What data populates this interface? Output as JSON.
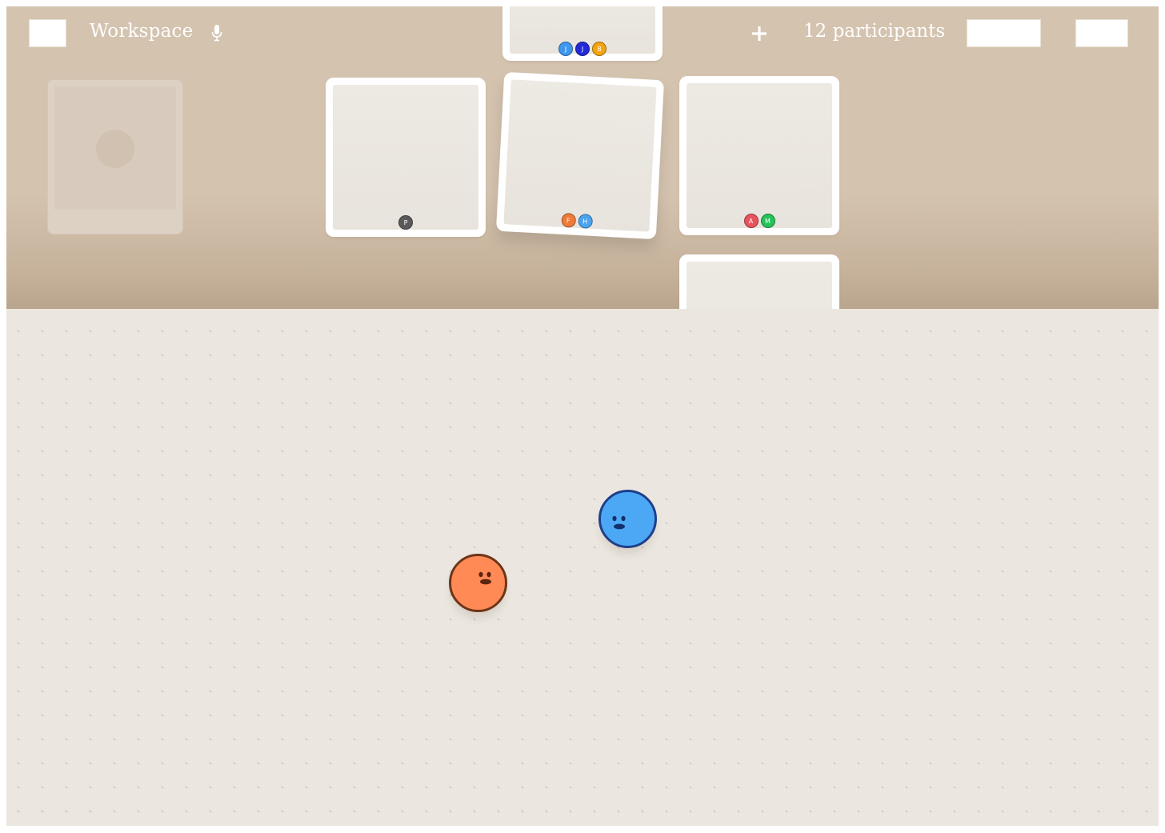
{
  "header": {
    "workspace_title": "Workspace",
    "participants_count": "12 participants",
    "icons": {
      "menu": "menu-button",
      "mic": "microphone-icon",
      "add": "plus-icon"
    }
  },
  "rooms": {
    "top": {
      "avatars": [
        {
          "initial": "J",
          "color": "#3f97ef"
        },
        {
          "initial": "J",
          "color": "#2329d8"
        },
        {
          "initial": "B",
          "color": "#f3a40e"
        }
      ]
    },
    "left": {
      "avatars": [
        {
          "initial": "P",
          "color": "#5a5a5a"
        }
      ]
    },
    "center": {
      "avatars": [
        {
          "initial": "F",
          "color": "#ef7b3a"
        },
        {
          "initial": "H",
          "color": "#4ca3ee"
        }
      ]
    },
    "right": {
      "avatars": [
        {
          "initial": "A",
          "color": "#e8545d"
        },
        {
          "initial": "M",
          "color": "#25c25a"
        }
      ]
    }
  },
  "characters": [
    {
      "name": "orange",
      "color": "#ff8a55",
      "outline": "#6e3518"
    },
    {
      "name": "blue",
      "color": "#4ca8f5",
      "outline": "#1f3f8a"
    }
  ],
  "theme": {
    "top_area": "#d4c3af",
    "canvas": "#ebe7e0",
    "card": "#ffffff"
  }
}
